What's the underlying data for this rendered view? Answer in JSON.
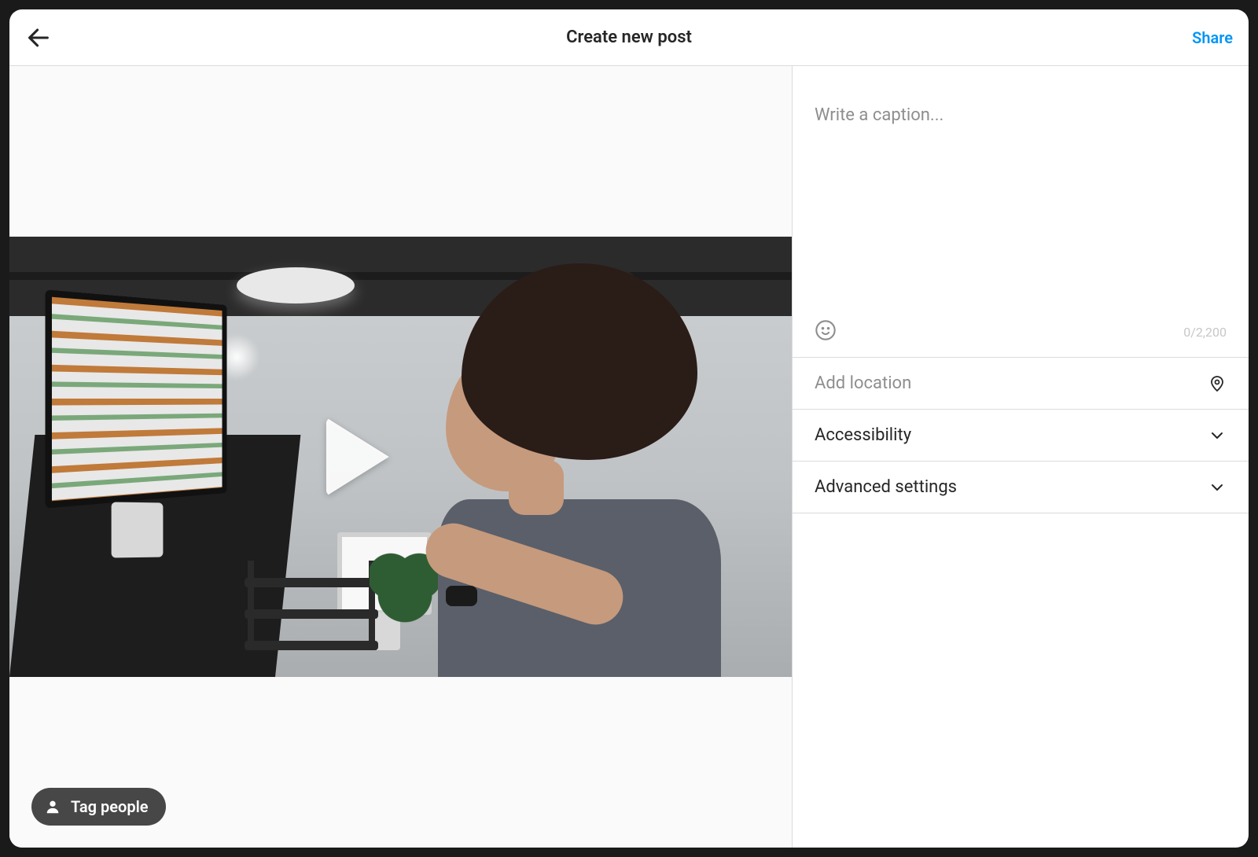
{
  "header": {
    "title": "Create new post",
    "share_label": "Share"
  },
  "preview": {
    "tag_people_label": "Tag people"
  },
  "sidepanel": {
    "caption_placeholder": "Write a caption...",
    "caption_value": "",
    "char_counter": "0/2,200",
    "location_label": "Add location",
    "accessibility_label": "Accessibility",
    "advanced_label": "Advanced settings"
  },
  "icons": {
    "back": "arrow-left-icon",
    "play": "play-icon",
    "person": "person-icon",
    "emoji": "smiley-icon",
    "location": "location-pin-icon",
    "chevron": "chevron-down-icon"
  }
}
